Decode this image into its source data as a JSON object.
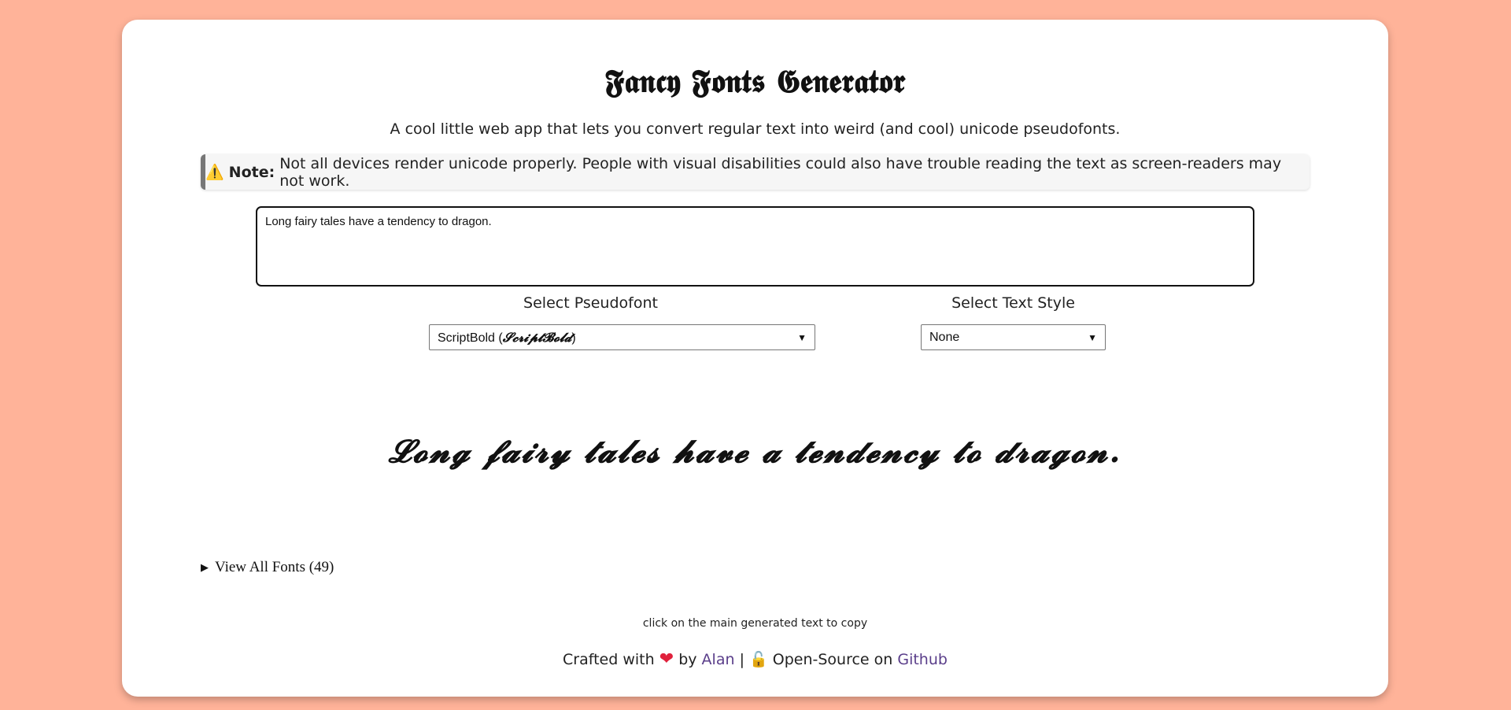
{
  "header": {
    "title": "𝕱𝖆𝖓𝖈𝖞 𝕱𝖔𝖓𝖙𝖘 𝕲𝖊𝖓𝖊𝖗𝖆𝖙𝖔𝖗",
    "subtitle": "A cool little web app that lets you convert regular text into weird (and cool) unicode pseudofonts."
  },
  "note": {
    "icon": "⚠️",
    "label": "Note:",
    "text": "Not all devices render unicode properly. People with visual disabilities could also have trouble reading the text as screen-readers may not work."
  },
  "input": {
    "value": "Long fairy tales have a tendency to dragon."
  },
  "pseudofont": {
    "label": "Select Pseudofont",
    "selected_name": "ScriptBold (",
    "selected_sample": "𝓢𝓬𝓻𝓲𝓹𝓽𝓑𝓸𝓵𝓭",
    "selected_close": ")"
  },
  "style": {
    "label": "Select Text Style",
    "selected": "None"
  },
  "output": {
    "text": "𝓛𝓸𝓷𝓰 𝓯𝓪𝓲𝓻𝔂 𝓽𝓪𝓵𝓮𝓼 𝓱𝓪𝓿𝓮 𝓪 𝓽𝓮𝓷𝓭𝓮𝓷𝓬𝔂 𝓽𝓸 𝓭𝓻𝓪𝓰𝓸𝓷."
  },
  "all_fonts": {
    "label": "View All Fonts (49)"
  },
  "hint": "click on the main generated text to copy",
  "footer": {
    "crafted": "Crafted with",
    "by": "by",
    "author": "Alan",
    "separator": "|",
    "open_source": "Open-Source on",
    "repo": "Github"
  },
  "colors": {
    "background": "#ffb399",
    "card": "#ffffff",
    "link": "#5a3e8a",
    "heart": "#e0213c"
  }
}
